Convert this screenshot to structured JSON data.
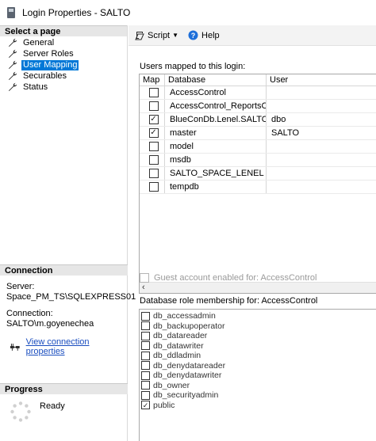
{
  "window": {
    "title": "Login Properties - SALTO"
  },
  "left_panel": {
    "select_page_header": "Select a page",
    "pages": [
      {
        "label": "General",
        "selected": false
      },
      {
        "label": "Server Roles",
        "selected": false
      },
      {
        "label": "User Mapping",
        "selected": true
      },
      {
        "label": "Securables",
        "selected": false
      },
      {
        "label": "Status",
        "selected": false
      }
    ],
    "connection": {
      "header": "Connection",
      "server_label": "Server:",
      "server_value": "Space_PM_TS\\SQLEXPRESS01",
      "connection_label": "Connection:",
      "connection_value": "SALTO\\m.goyenechea",
      "view_link": "View connection properties"
    },
    "progress": {
      "header": "Progress",
      "status": "Ready"
    }
  },
  "toolbar": {
    "script_label": "Script",
    "help_label": "Help"
  },
  "users_mapped": {
    "label": "Users mapped to this login:",
    "columns": [
      "Map",
      "Database",
      "User"
    ],
    "rows": [
      {
        "map": false,
        "database": "AccessControl",
        "user": ""
      },
      {
        "map": false,
        "database": "AccessControl_ReportsC...",
        "user": ""
      },
      {
        "map": true,
        "database": "BlueConDb.Lenel.SALTO",
        "user": "dbo"
      },
      {
        "map": true,
        "database": "master",
        "user": "SALTO"
      },
      {
        "map": false,
        "database": "model",
        "user": ""
      },
      {
        "map": false,
        "database": "msdb",
        "user": ""
      },
      {
        "map": false,
        "database": "SALTO_SPACE_LENEL",
        "user": ""
      },
      {
        "map": false,
        "database": "tempdb",
        "user": ""
      }
    ]
  },
  "guest": {
    "label": "Guest account enabled for: AccessControl",
    "checked": false
  },
  "role_membership": {
    "label": "Database role membership for: AccessControl",
    "roles": [
      {
        "name": "db_accessadmin",
        "checked": false
      },
      {
        "name": "db_backupoperator",
        "checked": false
      },
      {
        "name": "db_datareader",
        "checked": false
      },
      {
        "name": "db_datawriter",
        "checked": false
      },
      {
        "name": "db_ddladmin",
        "checked": false
      },
      {
        "name": "db_denydatareader",
        "checked": false
      },
      {
        "name": "db_denydatawriter",
        "checked": false
      },
      {
        "name": "db_owner",
        "checked": false
      },
      {
        "name": "db_securityadmin",
        "checked": false
      },
      {
        "name": "public",
        "checked": true
      }
    ]
  },
  "icons": {
    "app": "server-login-icon",
    "page": "wrench-icon",
    "script": "script-icon",
    "help": "help-icon",
    "connection": "connection-plug-icon",
    "progress": "spinner-icon"
  },
  "colors": {
    "selection": "#0078d7",
    "link": "#1a4dbf",
    "help": "#1e6fd9"
  }
}
